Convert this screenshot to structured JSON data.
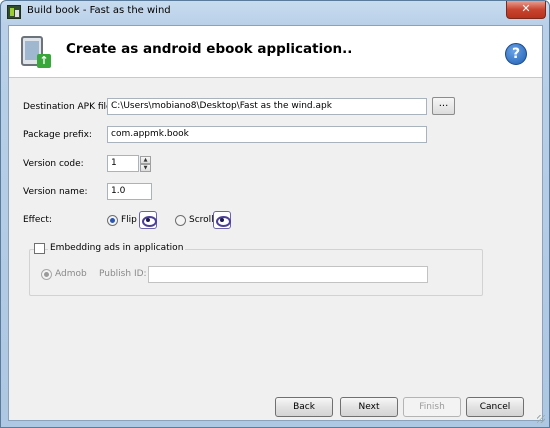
{
  "window": {
    "title": "Build book - Fast as the wind",
    "close_label": "✕"
  },
  "header": {
    "title": "Create as android ebook application..",
    "help_label": "?"
  },
  "form": {
    "destination_label": "Destination APK file:",
    "destination_value": "C:\\Users\\mobiano8\\Desktop\\Fast as the wind.apk",
    "browse_label": "...",
    "package_label": "Package prefix:",
    "package_value": "com.appmk.book",
    "version_code_label": "Version code:",
    "version_code_value": "1",
    "version_name_label": "Version name:",
    "version_name_value": "1.0",
    "effect_label": "Effect:",
    "effect_options": [
      {
        "label": "Flip",
        "selected": true
      },
      {
        "label": "Scroll",
        "selected": false
      }
    ]
  },
  "ads": {
    "group_title": "Embedding ads in application",
    "enabled": false,
    "provider_label": "Admob",
    "publish_id_label": "Publish ID:",
    "publish_id_value": ""
  },
  "buttons": {
    "back": "Back",
    "next": "Next",
    "finish": "Finish",
    "cancel": "Cancel"
  }
}
